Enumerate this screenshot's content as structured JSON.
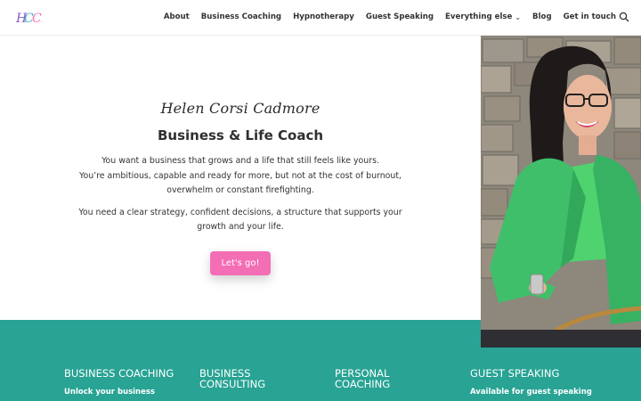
{
  "nav": {
    "items": [
      {
        "label": "About"
      },
      {
        "label": "Business Coaching"
      },
      {
        "label": "Hypnotherapy"
      },
      {
        "label": "Guest Speaking"
      },
      {
        "label": "Everything else"
      },
      {
        "label": "Blog"
      },
      {
        "label": "Get in touch"
      }
    ]
  },
  "hero": {
    "signature": "Helen Corsi Cadmore",
    "title": "Business & Life Coach",
    "para1_line1": "You want a business that grows and a life that still feels like yours.",
    "para1_line2": "You’re ambitious, capable and ready for more, but not at the cost of burnout,",
    "para1_line3": "overwhelm or constant firefighting.",
    "para2_line1": "You need a clear strategy, confident decisions, a structure that supports your",
    "para2_line2": "growth and your life.",
    "cta_label": "Let's go!"
  },
  "services": [
    {
      "title_line1": "BUSINESS COACHING",
      "title_line2": "",
      "subtitle": "Unlock your business"
    },
    {
      "title_line1": "BUSINESS",
      "title_line2": "CONSULTING",
      "subtitle": ""
    },
    {
      "title_line1": "PERSONAL",
      "title_line2": "COACHING",
      "subtitle": ""
    },
    {
      "title_line1": "GUEST SPEAKING",
      "title_line2": "",
      "subtitle": "Available for guest speaking"
    }
  ],
  "colors": {
    "accent_pink": "#f36eb5",
    "teal": "#28a394",
    "jacket_green": "#3fbf6a"
  },
  "icons": {
    "logo": "hcc-logo",
    "search": "search-icon",
    "dropdown": "chevron-down-icon"
  }
}
